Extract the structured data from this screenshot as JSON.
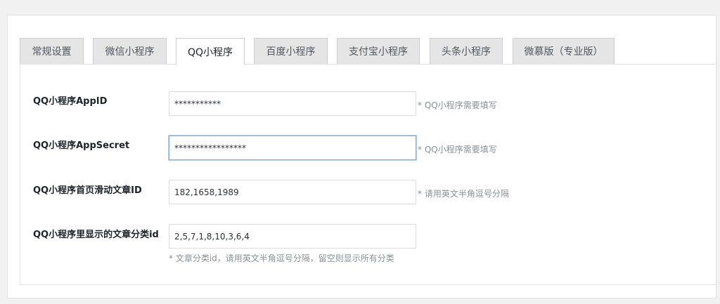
{
  "tabs": [
    {
      "label": "常规设置",
      "active": false
    },
    {
      "label": "微信小程序",
      "active": false
    },
    {
      "label": "QQ小程序",
      "active": true
    },
    {
      "label": "百度小程序",
      "active": false
    },
    {
      "label": "支付宝小程序",
      "active": false
    },
    {
      "label": "头条小程序",
      "active": false
    },
    {
      "label": "微慕版（专业版）",
      "active": false
    }
  ],
  "fields": [
    {
      "label": "QQ小程序AppID",
      "value": "***********",
      "hint": "* QQ小程序需要填写"
    },
    {
      "label": "QQ小程序AppSecret",
      "value": "*****************",
      "hint": "* QQ小程序需要填写"
    },
    {
      "label": "QQ小程序首页滑动文章ID",
      "value": "182,1658,1989",
      "hint": "* 请用英文半角逗号分隔"
    },
    {
      "label": "QQ小程序里显示的文章分类id",
      "value": "2,5,7,1,8,10,3,6,4",
      "hint": "* 文章分类id，请用英文半角逗号分隔，留空则显示所有分类"
    }
  ],
  "colors": {
    "focus_border": "#72aee6",
    "tab_inactive_bg": "#e5e5e5",
    "hint_text": "#8c8f94"
  }
}
